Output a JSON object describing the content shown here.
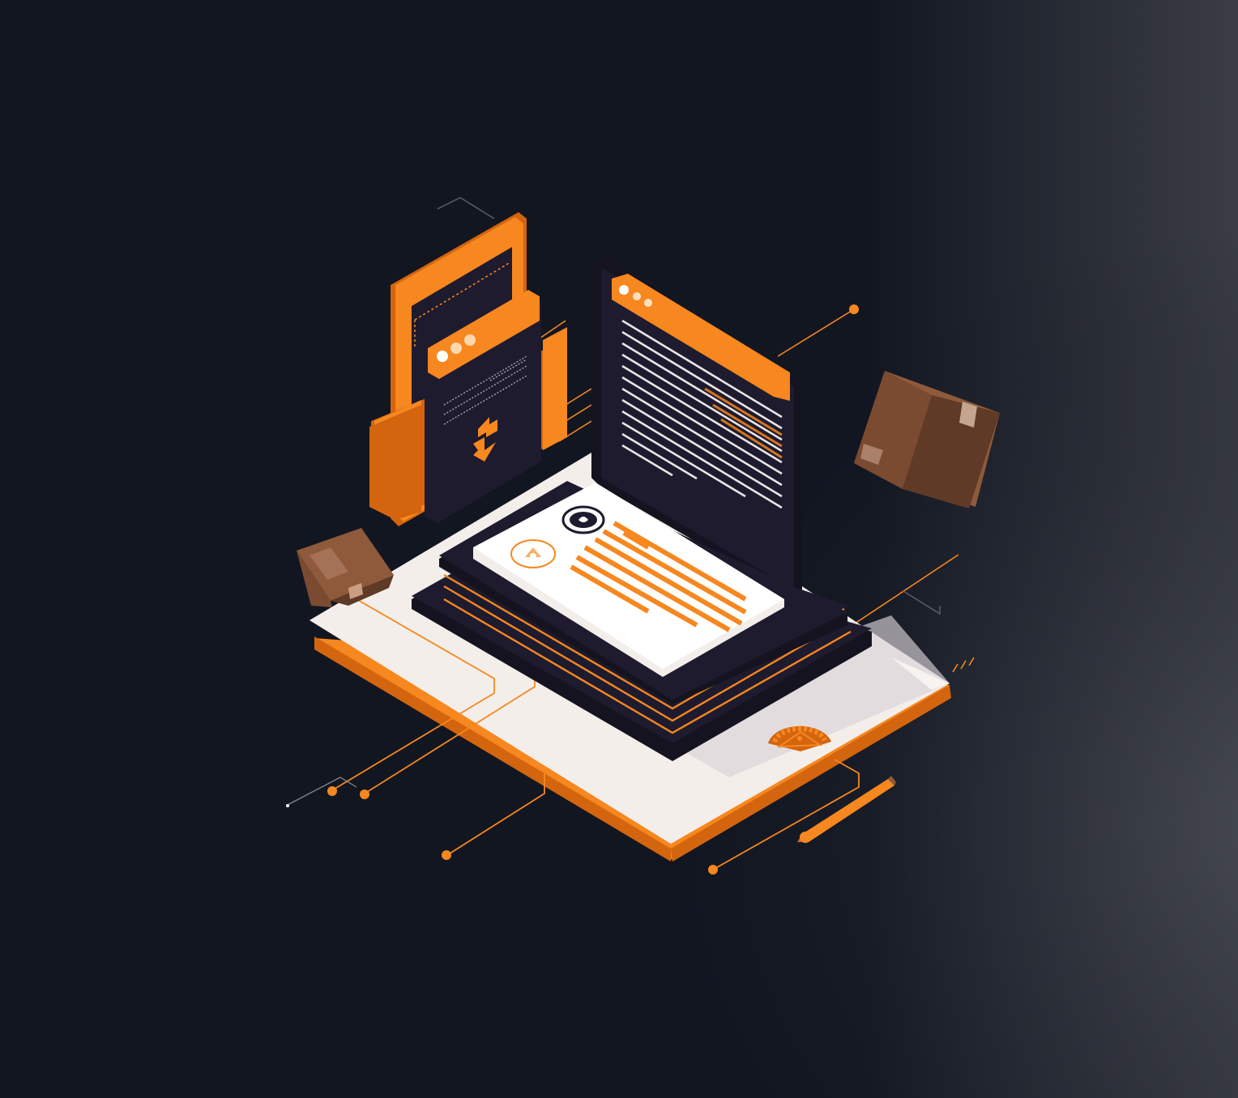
{
  "illustration": {
    "style": "isometric",
    "subject": "documents-and-packages",
    "text_content": []
  },
  "colors": {
    "background": "#121621",
    "background_edge": "#3a3d44",
    "accent": "#f7871f",
    "accent_dark": "#d4650f",
    "panel_dark": "#1e1b2e",
    "panel_darker": "#15131f",
    "paper": "#f3eeea",
    "paper_shadow": "#d9d2d2",
    "box_light": "#8e5a3b",
    "box_mid": "#7a4a31",
    "box_dark": "#5f3a26",
    "line_white": "#e9e4e6"
  },
  "icons": [
    "transfer-arrows-icon",
    "shield-icon",
    "gear-icon",
    "pencil-icon",
    "package-box-icon"
  ]
}
